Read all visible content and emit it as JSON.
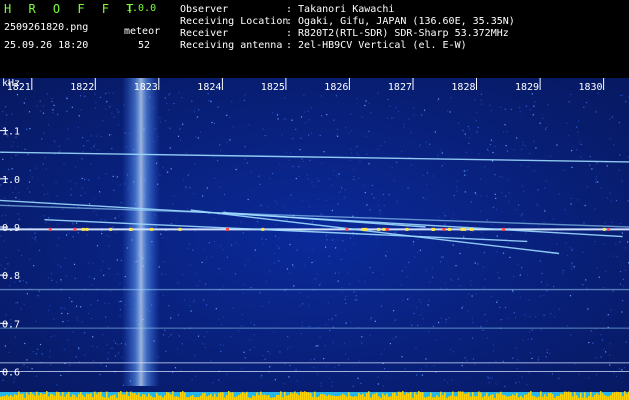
{
  "header": {
    "app_title": "H R O F F T",
    "app_version": "1.0.0",
    "filename": "2509261820.png",
    "datetime": "25.09.26 18:20",
    "meteor_label": "meteor",
    "meteor_count": "52",
    "observer_label": "Observer",
    "observer_value": ": Takanori Kawachi",
    "location_label": "Receiving Location",
    "location_value": ": Ogaki, Gifu, JAPAN (136.60E, 35.35N)",
    "receiver_label": "Receiver",
    "receiver_value": ": R820T2(RTL-SDR) SDR-Sharp 53.372MHz",
    "antenna_label": "Receiving antenna",
    "antenna_value": ": 2el-HB9CV Vertical (el. E-W)"
  },
  "chart_data": {
    "type": "heatmap",
    "ylabel": "kHz",
    "x_ticks": [
      "1821",
      "1822",
      "1823",
      "1824",
      "1825",
      "1826",
      "1827",
      "1828",
      "1829",
      "1830"
    ],
    "x_range": [
      1820.5,
      1830.4
    ],
    "y_ticks": [
      "1.1",
      "1.0",
      "0.9",
      "0.8",
      "0.7",
      "0.6"
    ],
    "y_range": [
      0.57,
      1.18
    ],
    "colors": {
      "background": "#071a6b",
      "axis_text": "#ffffff",
      "baseline": "#cfe0ff",
      "meteor_trace": "#9fdcff",
      "signal_hot": "#ff4a4a",
      "signal_warm": "#ffe54a",
      "level_bar": "#ffd400",
      "level_bar_base": "#27b6e8"
    }
  }
}
